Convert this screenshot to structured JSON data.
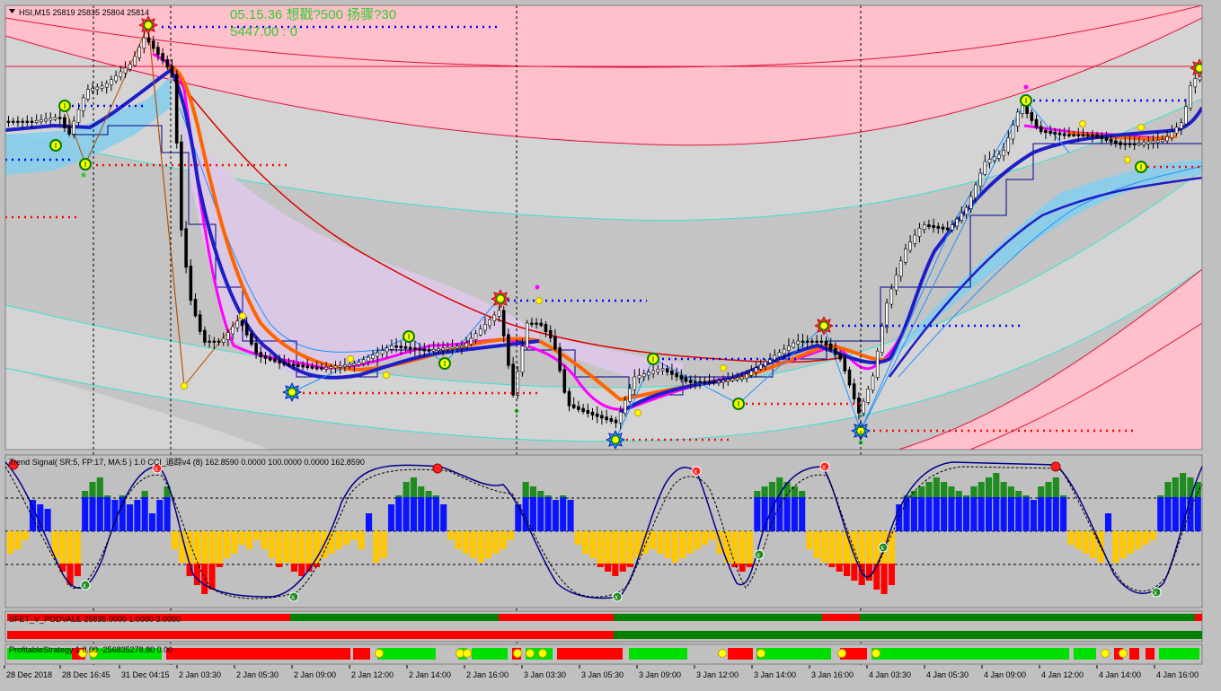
{
  "main_chart": {
    "symbol_header": "HSI,M15  25819 25835 25804 25814",
    "overlay_line1": "05.15.36 想戳?500 扬骤?30",
    "overlay_line2": "5447.00 : 0",
    "colors": {
      "text_green": "#32cd32",
      "background": "#c0c0c0",
      "band_pink": "#ffc0cb",
      "band_light": "#d3d3d3",
      "cloud_blue": "#87ceeb",
      "cloud_pink": "#dcc8e6",
      "ma_blue": "#1e1ec8",
      "ma_magenta": "#ff00ff",
      "ma_orange": "#ff6400",
      "signal_red": "#ff0000",
      "signal_blue": "#0000ff"
    }
  },
  "indicator1": {
    "label": "Trend Signal( SR:5, FP:17, MA:5 ) 1.0  CCI_追踪v4 (8) 162.8590 0.0000 100.0000 0.0000 162.8590"
  },
  "indicator2": {
    "label": "SFET_V_PODVALE 25835.0000 1.0000 3.0000"
  },
  "indicator3": {
    "label": "ProfitableStrategy 1 0.00 -256835278.80 0.00"
  },
  "time_axis": {
    "labels": [
      "28 Dec 2018",
      "28 Dec 16:45",
      "31 Dec 04:15",
      "2 Jan 03:30",
      "2 Jan 05:30",
      "2 Jan 09:00",
      "2 Jan 12:00",
      "2 Jan 14:00",
      "2 Jan 16:00",
      "3 Jan 03:30",
      "3 Jan 05:30",
      "3 Jan 09:00",
      "3 Jan 12:00",
      "3 Jan 14:00",
      "3 Jan 16:00",
      "4 Jan 03:30",
      "4 Jan 05:30",
      "4 Jan 09:00",
      "4 Jan 12:00",
      "4 Jan 14:00",
      "4 Jan 16:00"
    ]
  }
}
